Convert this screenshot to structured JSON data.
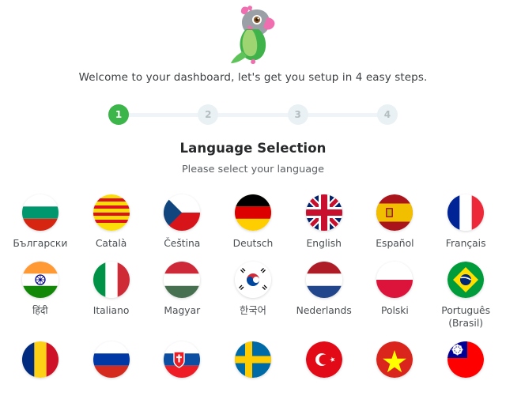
{
  "branding": {
    "logo_name": "parrot-logo",
    "logo_colors": {
      "body_green": "#5ec45a",
      "wing_green": "#a5d87e",
      "head_gray": "#9aa0a6",
      "crest_pink": "#f06eb0",
      "eye_brown": "#8a5a2b"
    }
  },
  "welcome": {
    "message": "Welcome to your dashboard, let's get you setup in 4 easy steps."
  },
  "stepper": {
    "current_step": 1,
    "active_color": "#3cb54a",
    "inactive_color": "#eaf1f4",
    "steps": [
      {
        "label": "1",
        "state": "active"
      },
      {
        "label": "2",
        "state": "inactive"
      },
      {
        "label": "3",
        "state": "inactive"
      },
      {
        "label": "4",
        "state": "inactive"
      }
    ]
  },
  "section": {
    "title": "Language Selection",
    "subtitle": "Please select your language"
  },
  "languages": [
    {
      "label": "Български",
      "flag": "flag-bulgaria-icon"
    },
    {
      "label": "Català",
      "flag": "flag-catalonia-icon"
    },
    {
      "label": "Čeština",
      "flag": "flag-czechia-icon"
    },
    {
      "label": "Deutsch",
      "flag": "flag-germany-icon"
    },
    {
      "label": "English",
      "flag": "flag-united-kingdom-icon"
    },
    {
      "label": "Español",
      "flag": "flag-spain-icon"
    },
    {
      "label": "Français",
      "flag": "flag-france-icon"
    },
    {
      "label": "हिंदी",
      "flag": "flag-india-icon"
    },
    {
      "label": "Italiano",
      "flag": "flag-italy-icon"
    },
    {
      "label": "Magyar",
      "flag": "flag-hungary-icon"
    },
    {
      "label": "한국어",
      "flag": "flag-south-korea-icon"
    },
    {
      "label": "Nederlands",
      "flag": "flag-netherlands-icon"
    },
    {
      "label": "Polski",
      "flag": "flag-poland-icon"
    },
    {
      "label": "Português (Brasil)",
      "flag": "flag-brazil-icon"
    },
    {
      "label": "",
      "flag": "flag-romania-icon"
    },
    {
      "label": "",
      "flag": "flag-russia-icon"
    },
    {
      "label": "",
      "flag": "flag-slovakia-icon"
    },
    {
      "label": "",
      "flag": "flag-sweden-icon"
    },
    {
      "label": "",
      "flag": "flag-turkey-icon"
    },
    {
      "label": "",
      "flag": "flag-vietnam-icon"
    },
    {
      "label": "",
      "flag": "flag-taiwan-icon"
    }
  ]
}
